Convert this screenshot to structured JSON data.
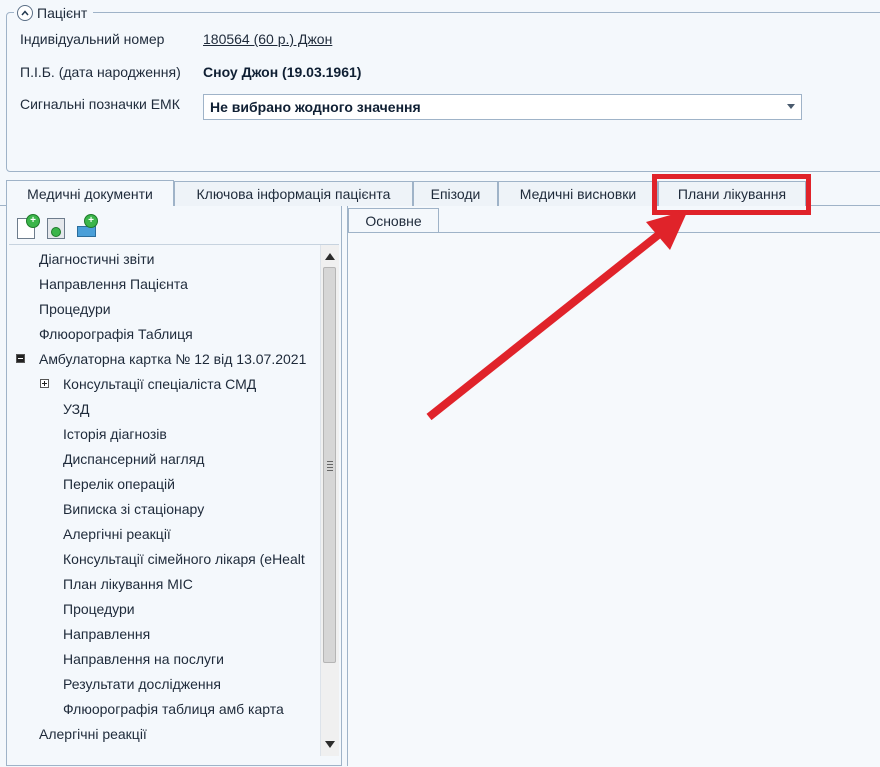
{
  "patient": {
    "group_title": "Пацієнт",
    "id_label": "Індивідуальний номер",
    "id_value": "180564 (60 р.) Джон",
    "name_label": "П.І.Б. (дата народження)",
    "name_value": "Сноу Джон (19.03.1961)",
    "signals_label": "Сигнальні позначки ЕМК",
    "signals_value": "Не вибрано жодного значення"
  },
  "tabs": [
    {
      "label": "Медичні документи",
      "active": true
    },
    {
      "label": "Ключова інформація пацієнта",
      "active": false
    },
    {
      "label": "Епізоди",
      "active": false
    },
    {
      "label": "Медичні висновки",
      "active": false
    },
    {
      "label": "Плани лікування",
      "active": false
    }
  ],
  "toolbar": {
    "icons": [
      "new-document-icon",
      "copy-document-icon",
      "add-record-icon"
    ]
  },
  "tree": {
    "items": [
      {
        "label": "Діагностичні звіти",
        "level": 0
      },
      {
        "label": "Направлення Пацієнта",
        "level": 0
      },
      {
        "label": "Процедури",
        "level": 0
      },
      {
        "label": "Флюорографія Таблиця",
        "level": 0
      },
      {
        "label": "Амбулаторна картка № 12 від 13.07.2021",
        "level": 0,
        "expander": "minus"
      },
      {
        "label": "Консультації спеціаліста СМД",
        "level": 1,
        "expander": "plus"
      },
      {
        "label": "УЗД",
        "level": 1
      },
      {
        "label": "Історія діагнозів",
        "level": 1
      },
      {
        "label": "Диспансерний нагляд",
        "level": 1
      },
      {
        "label": "Перелік операцій",
        "level": 1
      },
      {
        "label": "Виписка зі стаціонару",
        "level": 1
      },
      {
        "label": "Алергічні реакції",
        "level": 1
      },
      {
        "label": "Консультації сімейного лікаря (eHealt",
        "level": 1
      },
      {
        "label": "План лікування МІС",
        "level": 1
      },
      {
        "label": "Процедури",
        "level": 1
      },
      {
        "label": "Направлення",
        "level": 1
      },
      {
        "label": "Направлення на послуги",
        "level": 1
      },
      {
        "label": "Результати дослідження",
        "level": 1
      },
      {
        "label": "Флюорографія таблиця амб карта",
        "level": 1
      },
      {
        "label": "Алергічні реакції",
        "level": 0
      }
    ]
  },
  "subtabs": [
    {
      "label": "Основне"
    }
  ],
  "colors": {
    "highlight": "#e0232a",
    "accent_border": "#9fb3c8",
    "background": "#f4f8fc"
  }
}
